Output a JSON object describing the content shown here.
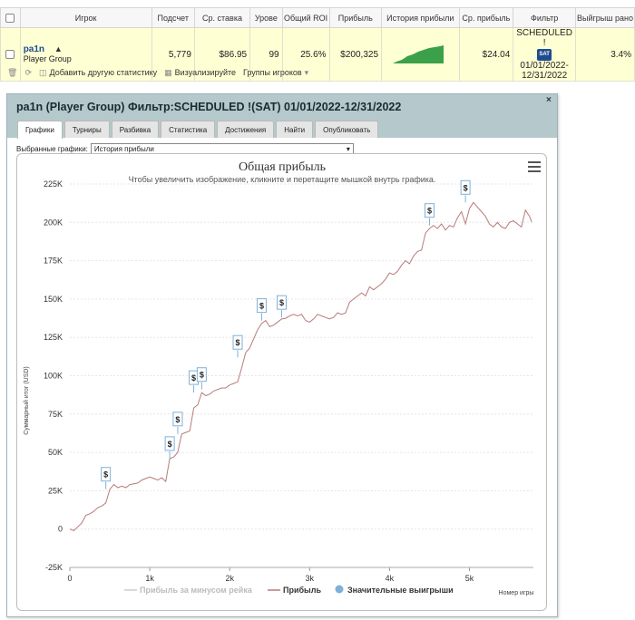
{
  "stats_table": {
    "columns": [
      "",
      "Игрок",
      "Подсчет",
      "Ср. ставка",
      "Урове",
      "Общий ROI",
      "Прибыль",
      "История прибыли",
      "Ср. прибыль",
      "Фильтр",
      "Выйгрыш рано"
    ],
    "row": {
      "player_name": "pa1n",
      "player_group": "Player Group",
      "count": "5,779",
      "avg_stake": "$86.95",
      "level": "99",
      "roi": "25.6%",
      "profit": "$200,325",
      "avg_profit": "$24.04",
      "filter_line1": "SCHEDULED !",
      "filter_badge": "SAT",
      "filter_line2": "01/01/2022-",
      "filter_line3": "12/31/2022",
      "early_win": "3.4%"
    },
    "header_last_visible": "Выйгрыш рано"
  },
  "toolbar": {
    "add_stat": "Добавить другую статистику",
    "visualize": "Визуализируйте",
    "groups": "Группы игроков"
  },
  "dialog": {
    "title": "pa1n (Player Group) Фильтр:SCHEDULED !(SAT) 01/01/2022-12/31/2022",
    "close": "×",
    "tabs": [
      "Графики",
      "Турниры",
      "Разбивка",
      "Статистика",
      "Достижения",
      "Найти",
      "Опубликовать"
    ],
    "charts_label": "Выбранные графики:",
    "charts_value": "История прибыли"
  },
  "colors": {
    "profit_line": "#b97a7a",
    "rake_line": "#cccccc",
    "wins_marker": "#7fb1d8",
    "sparkline": "#3aa14a",
    "dialog_header": "#b5c9cd"
  },
  "chart_data": {
    "type": "line",
    "title": "Общая прибыль",
    "subtitle": "Чтобы увеличить изображение, кликните и перетащите мышкой внутрь графика.",
    "ylabel": "Суммарный итог (USD)",
    "xlabel": "Номер игры",
    "ylim": [
      -25000,
      225000
    ],
    "xlim": [
      0,
      5800
    ],
    "yticks": [
      "-25K",
      "0",
      "25K",
      "50K",
      "75K",
      "100K",
      "125K",
      "150K",
      "175K",
      "200K",
      "225K"
    ],
    "xticks": [
      "0",
      "1k",
      "2k",
      "3k",
      "4k",
      "5k"
    ],
    "legend": [
      "Прибыль за минусом рейка",
      "Прибыль",
      "Значительные выигрыши"
    ],
    "legend_position": "bottom-center",
    "grid": true,
    "marker_symbol": "$",
    "series": [
      {
        "name": "Прибыль",
        "x": [
          0,
          50,
          100,
          150,
          200,
          250,
          300,
          350,
          400,
          450,
          500,
          550,
          600,
          650,
          700,
          750,
          800,
          850,
          900,
          950,
          1000,
          1050,
          1100,
          1150,
          1200,
          1250,
          1300,
          1350,
          1400,
          1450,
          1500,
          1550,
          1600,
          1650,
          1700,
          1750,
          1800,
          1850,
          1900,
          1950,
          2000,
          2050,
          2100,
          2150,
          2200,
          2250,
          2300,
          2350,
          2400,
          2450,
          2500,
          2550,
          2600,
          2650,
          2700,
          2750,
          2800,
          2850,
          2900,
          2950,
          3000,
          3050,
          3100,
          3150,
          3200,
          3250,
          3300,
          3350,
          3400,
          3450,
          3500,
          3550,
          3600,
          3650,
          3700,
          3750,
          3800,
          3850,
          3900,
          3950,
          4000,
          4050,
          4100,
          4150,
          4200,
          4250,
          4300,
          4350,
          4400,
          4450,
          4500,
          4550,
          4600,
          4650,
          4700,
          4750,
          4800,
          4850,
          4900,
          4950,
          5000,
          5050,
          5100,
          5150,
          5200,
          5250,
          5300,
          5350,
          5400,
          5450,
          5500,
          5550,
          5600,
          5650,
          5700,
          5750,
          5779
        ],
        "y": [
          0,
          -1000,
          1500,
          4000,
          9000,
          10000,
          11500,
          14000,
          15000,
          17000,
          26000,
          29000,
          27000,
          28000,
          27000,
          29000,
          29500,
          30000,
          32000,
          33000,
          34000,
          33000,
          32000,
          33500,
          31000,
          46000,
          47000,
          50000,
          62000,
          63000,
          64000,
          79000,
          81000,
          89000,
          87000,
          88000,
          90000,
          91000,
          92000,
          92000,
          94000,
          95000,
          96000,
          105000,
          115000,
          118000,
          124000,
          130000,
          134000,
          136000,
          132000,
          133000,
          135000,
          137000,
          137500,
          139000,
          140000,
          139000,
          140000,
          136000,
          135000,
          137000,
          140000,
          139000,
          138000,
          137000,
          138000,
          141000,
          140000,
          141000,
          148000,
          150000,
          152000,
          154000,
          152000,
          158000,
          156000,
          158000,
          160000,
          163000,
          167000,
          166000,
          168000,
          172000,
          175000,
          173000,
          178000,
          181000,
          182000,
          193000,
          196000,
          198000,
          196000,
          199000,
          195000,
          198000,
          197000,
          203000,
          207000,
          199000,
          209000,
          213000,
          210000,
          207000,
          204000,
          199000,
          197000,
          200000,
          197000,
          196000,
          200000,
          201000,
          199000,
          197000,
          208000,
          204000,
          200325
        ]
      }
    ],
    "significant_wins": [
      {
        "x": 450,
        "y": 26000
      },
      {
        "x": 1250,
        "y": 46000
      },
      {
        "x": 1350,
        "y": 62000
      },
      {
        "x": 1550,
        "y": 89000
      },
      {
        "x": 1650,
        "y": 91000
      },
      {
        "x": 2100,
        "y": 112000
      },
      {
        "x": 2400,
        "y": 136000
      },
      {
        "x": 2650,
        "y": 138000
      },
      {
        "x": 4500,
        "y": 198000
      },
      {
        "x": 4950,
        "y": 213000
      }
    ]
  }
}
